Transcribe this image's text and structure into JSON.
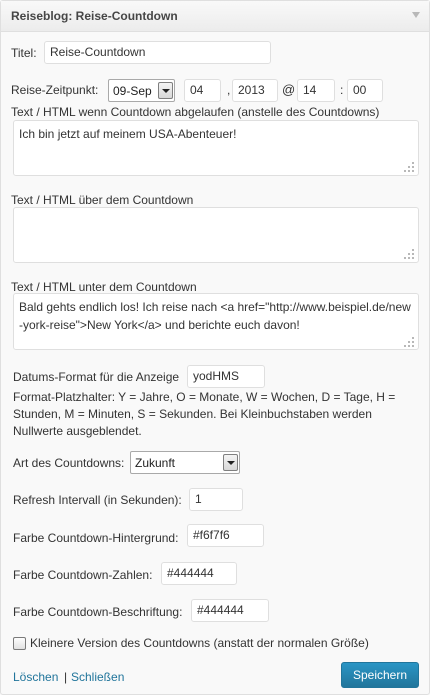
{
  "widget": {
    "title": "Reiseblog: Reise-Countdown",
    "title_suffix": ": Reise-Countdown"
  },
  "form": {
    "title_label": "Titel:",
    "title_value": "Reise-Countdown",
    "date_label": "Reise-Zeitpunkt:",
    "date_month": "09-Sep",
    "date_day": "04",
    "date_sep_dot": ",",
    "date_year": "2013",
    "time_at": "@",
    "time_hour": "14",
    "time_colon": ":",
    "time_minute": "00",
    "expired_label": "Text / HTML wenn Countdown abgelaufen (anstelle des Countdowns)",
    "expired_value": "Ich bin jetzt auf meinem USA-Abenteuer!",
    "above_label": "Text / HTML über dem Countdown",
    "above_value": "",
    "below_label": "Text / HTML unter dem Countdown",
    "below_value": "Bald gehts endlich los! Ich reise nach <a href=\"http://www.beispiel.de/new-york-reise\">New York</a> und berichte euch davon!",
    "format_label": "Datums-Format für die Anzeige",
    "format_value": "yodHMS",
    "format_help": "Format-Platzhalter: Y = Jahre, O = Monate, W = Wochen, D = Tage, H = Stunden, M = Minuten, S = Sekunden. Bei Kleinbuchstaben werden Nullwerte ausgeblendet.",
    "type_label": "Art des Countdowns:",
    "type_value": "Zukunft",
    "refresh_label": "Refresh Intervall (in Sekunden):",
    "refresh_value": "1",
    "bg_color_label": "Farbe Countdown-Hintergrund:",
    "bg_color_value": "#f6f7f6",
    "num_color_label": "Farbe Countdown-Zahlen:",
    "num_color_value": "#444444",
    "caption_color_label": "Farbe Countdown-Beschriftung:",
    "caption_color_value": "#444444",
    "small_version_label": "Kleinere Version des Countdowns (anstatt der normalen Größe)",
    "small_version_checked": false
  },
  "actions": {
    "delete_label": "Löschen",
    "separator": "|",
    "close_label": "Schließen",
    "save_label": "Speichern"
  },
  "colors": {
    "accent": "#21759b",
    "link": "#21759b",
    "panel": "#f9f9f9"
  }
}
